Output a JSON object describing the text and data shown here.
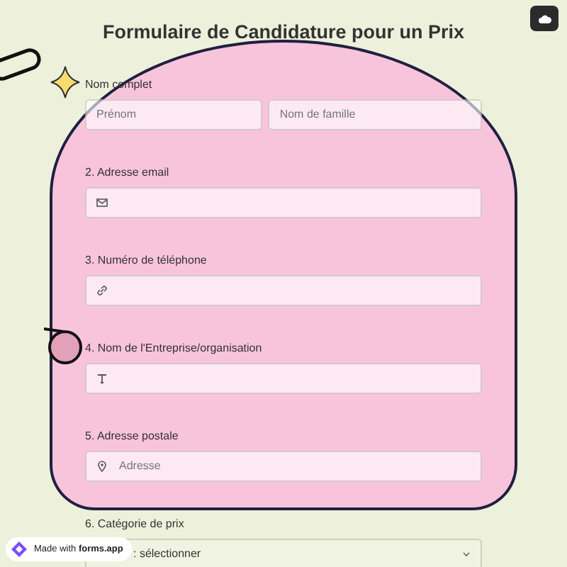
{
  "title": "Formulaire de Candidature pour un Prix",
  "fields": [
    {
      "kind": "name",
      "label": "Nom complet",
      "placeholders": [
        "Prénom",
        "Nom de famille"
      ]
    },
    {
      "kind": "email",
      "label": "2. Adresse email"
    },
    {
      "kind": "phone",
      "label": "3. Numéro de téléphone"
    },
    {
      "kind": "text",
      "label": "4. Nom de l'Entreprise/organisation"
    },
    {
      "kind": "address",
      "label": "5. Adresse postale",
      "placeholder": "Adresse"
    },
    {
      "kind": "select",
      "label": "6. Catégorie de prix",
      "value": ": sélectionner"
    }
  ],
  "badge": "Made with **forms.app**"
}
